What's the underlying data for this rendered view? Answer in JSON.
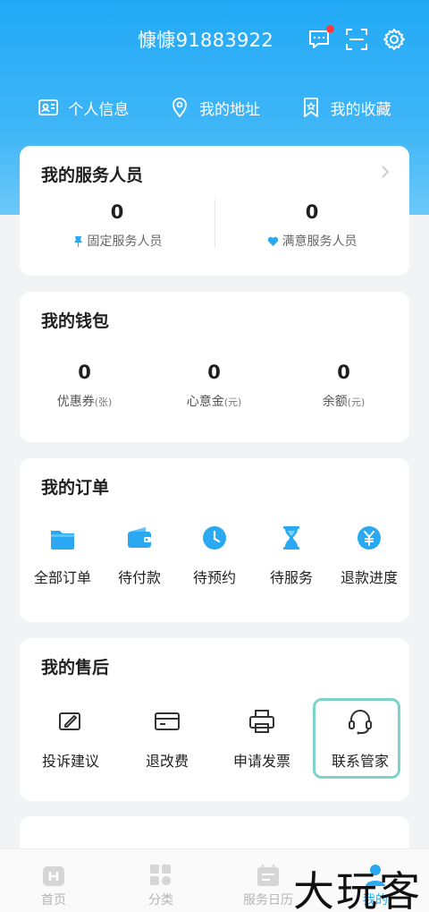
{
  "header": {
    "username": "慷慷91883922",
    "icons": [
      "message-icon",
      "scan-icon",
      "settings-icon"
    ]
  },
  "quicklinks": [
    {
      "label": "个人信息",
      "icon": "id-card-icon"
    },
    {
      "label": "我的地址",
      "icon": "location-icon"
    },
    {
      "label": "我的收藏",
      "icon": "bookmark-icon"
    }
  ],
  "service": {
    "title": "我的服务人员",
    "fixed": {
      "value": "0",
      "label": "固定服务人员"
    },
    "satisfied": {
      "value": "0",
      "label": "满意服务人员"
    }
  },
  "wallet": {
    "title": "我的钱包",
    "items": [
      {
        "value": "0",
        "label": "优惠券",
        "unit": "(张)"
      },
      {
        "value": "0",
        "label": "心意金",
        "unit": "(元)"
      },
      {
        "value": "0",
        "label": "余额",
        "unit": "(元)"
      }
    ]
  },
  "orders": {
    "title": "我的订单",
    "items": [
      {
        "label": "全部订单",
        "icon": "folder-icon"
      },
      {
        "label": "待付款",
        "icon": "wallet-icon"
      },
      {
        "label": "待预约",
        "icon": "clock-icon"
      },
      {
        "label": "待服务",
        "icon": "hourglass-icon"
      },
      {
        "label": "退款进度",
        "icon": "yen-icon"
      }
    ]
  },
  "aftersale": {
    "title": "我的售后",
    "items": [
      {
        "label": "投诉建议",
        "icon": "edit-icon"
      },
      {
        "label": "退改费",
        "icon": "card-icon"
      },
      {
        "label": "申请发票",
        "icon": "printer-icon"
      },
      {
        "label": "联系管家",
        "icon": "headset-icon"
      }
    ]
  },
  "tabs": [
    {
      "label": "首页",
      "icon": "home-icon"
    },
    {
      "label": "分类",
      "icon": "category-icon"
    },
    {
      "label": "服务日历",
      "icon": "calendar-icon"
    },
    {
      "label": "我的",
      "icon": "profile-icon"
    }
  ],
  "watermark": "大玩客",
  "colors": {
    "primary": "#2aa8f2",
    "highlight": "#7dd3c8",
    "notify": "#ff3b3b"
  }
}
